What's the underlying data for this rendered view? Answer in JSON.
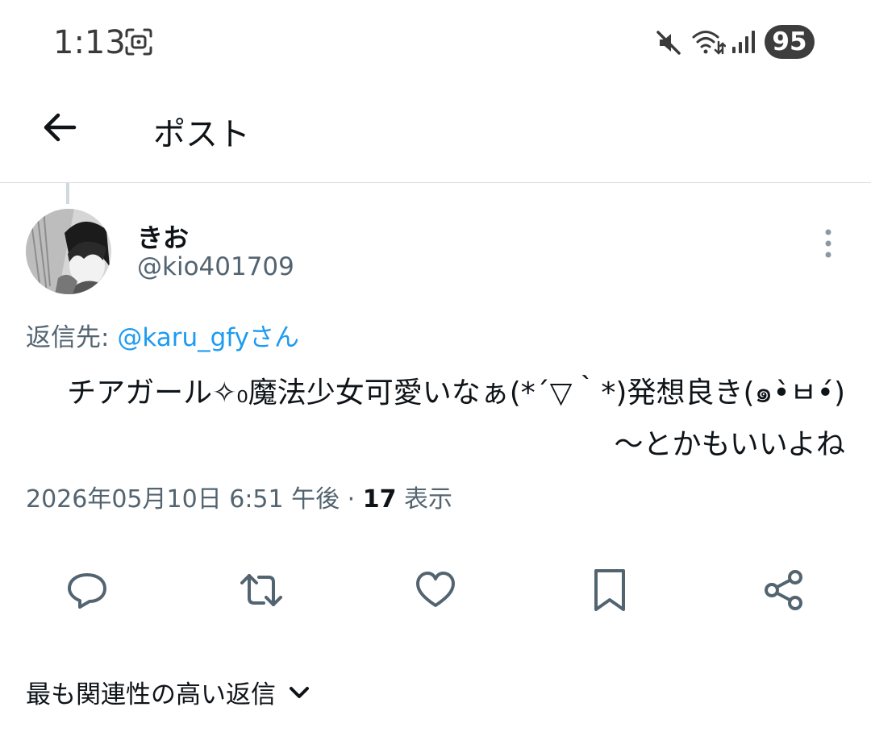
{
  "status_bar": {
    "time": "1:13",
    "battery": "95",
    "icons": [
      "screen-record-icon",
      "mute-icon",
      "wifi-icon",
      "signal-icon"
    ]
  },
  "header": {
    "back_icon": "arrow-left-icon",
    "title": "ポスト"
  },
  "tweet": {
    "display_name": "きお",
    "handle": "@kio401709",
    "reply_prefix": "返信先: ",
    "reply_mention": "@karu_gfyさん",
    "text_line1": "チアガール✧₀魔法少女可愛いなぁ(*´▽｀*)発想良き(๑•̀ㅂ•́)",
    "text_line2": "〜とかもいいよね",
    "date": "2026年05月10日 6:51 午後 · ",
    "views_count": "17",
    "views_label": " 表示",
    "more_icon": "more-vertical-icon"
  },
  "actions": [
    {
      "name": "reply",
      "icon": "reply-icon"
    },
    {
      "name": "retweet",
      "icon": "retweet-icon"
    },
    {
      "name": "like",
      "icon": "heart-icon"
    },
    {
      "name": "bookmark",
      "icon": "bookmark-icon"
    },
    {
      "name": "share",
      "icon": "share-icon"
    }
  ],
  "replies_sort": {
    "label": "最も関連性の高い返信",
    "icon": "chevron-down-icon"
  },
  "colors": {
    "text": "#0f1419",
    "secondary": "#536471",
    "link": "#1d9bf0",
    "divider": "#dcdfe3"
  }
}
